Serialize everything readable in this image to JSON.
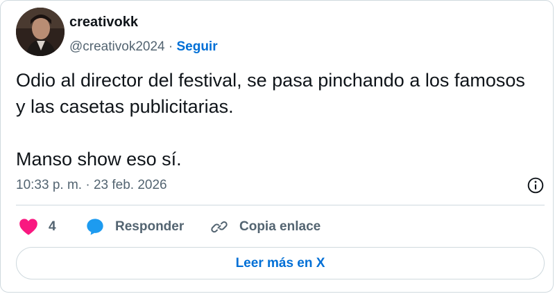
{
  "user": {
    "display_name": "creativokk",
    "handle": "@creativok2024",
    "separator": " · ",
    "follow_label": "Seguir"
  },
  "tweet": {
    "paragraph_1": "Odio al director del festival, se pasa pinchando a los famosos y las casetas publicitarias.",
    "paragraph_2": "Manso show eso sí.",
    "timestamp": "10:33 p. m. · 23 feb. 2026"
  },
  "actions": {
    "like_count": "4",
    "reply_label": "Responder",
    "copy_link_label": "Copia enlace"
  },
  "footer": {
    "read_more_label": "Leer más en X"
  },
  "colors": {
    "link_blue": "#006fd6",
    "heart_pink": "#f91880",
    "reply_blue": "#1d9bf0",
    "text_primary": "#0f1419",
    "text_secondary": "#536471",
    "border": "#cfd9de"
  },
  "icons": {
    "logo": "x-logo-icon",
    "info": "info-icon",
    "like": "heart-icon",
    "reply": "reply-bubble-icon",
    "copy": "link-icon"
  }
}
